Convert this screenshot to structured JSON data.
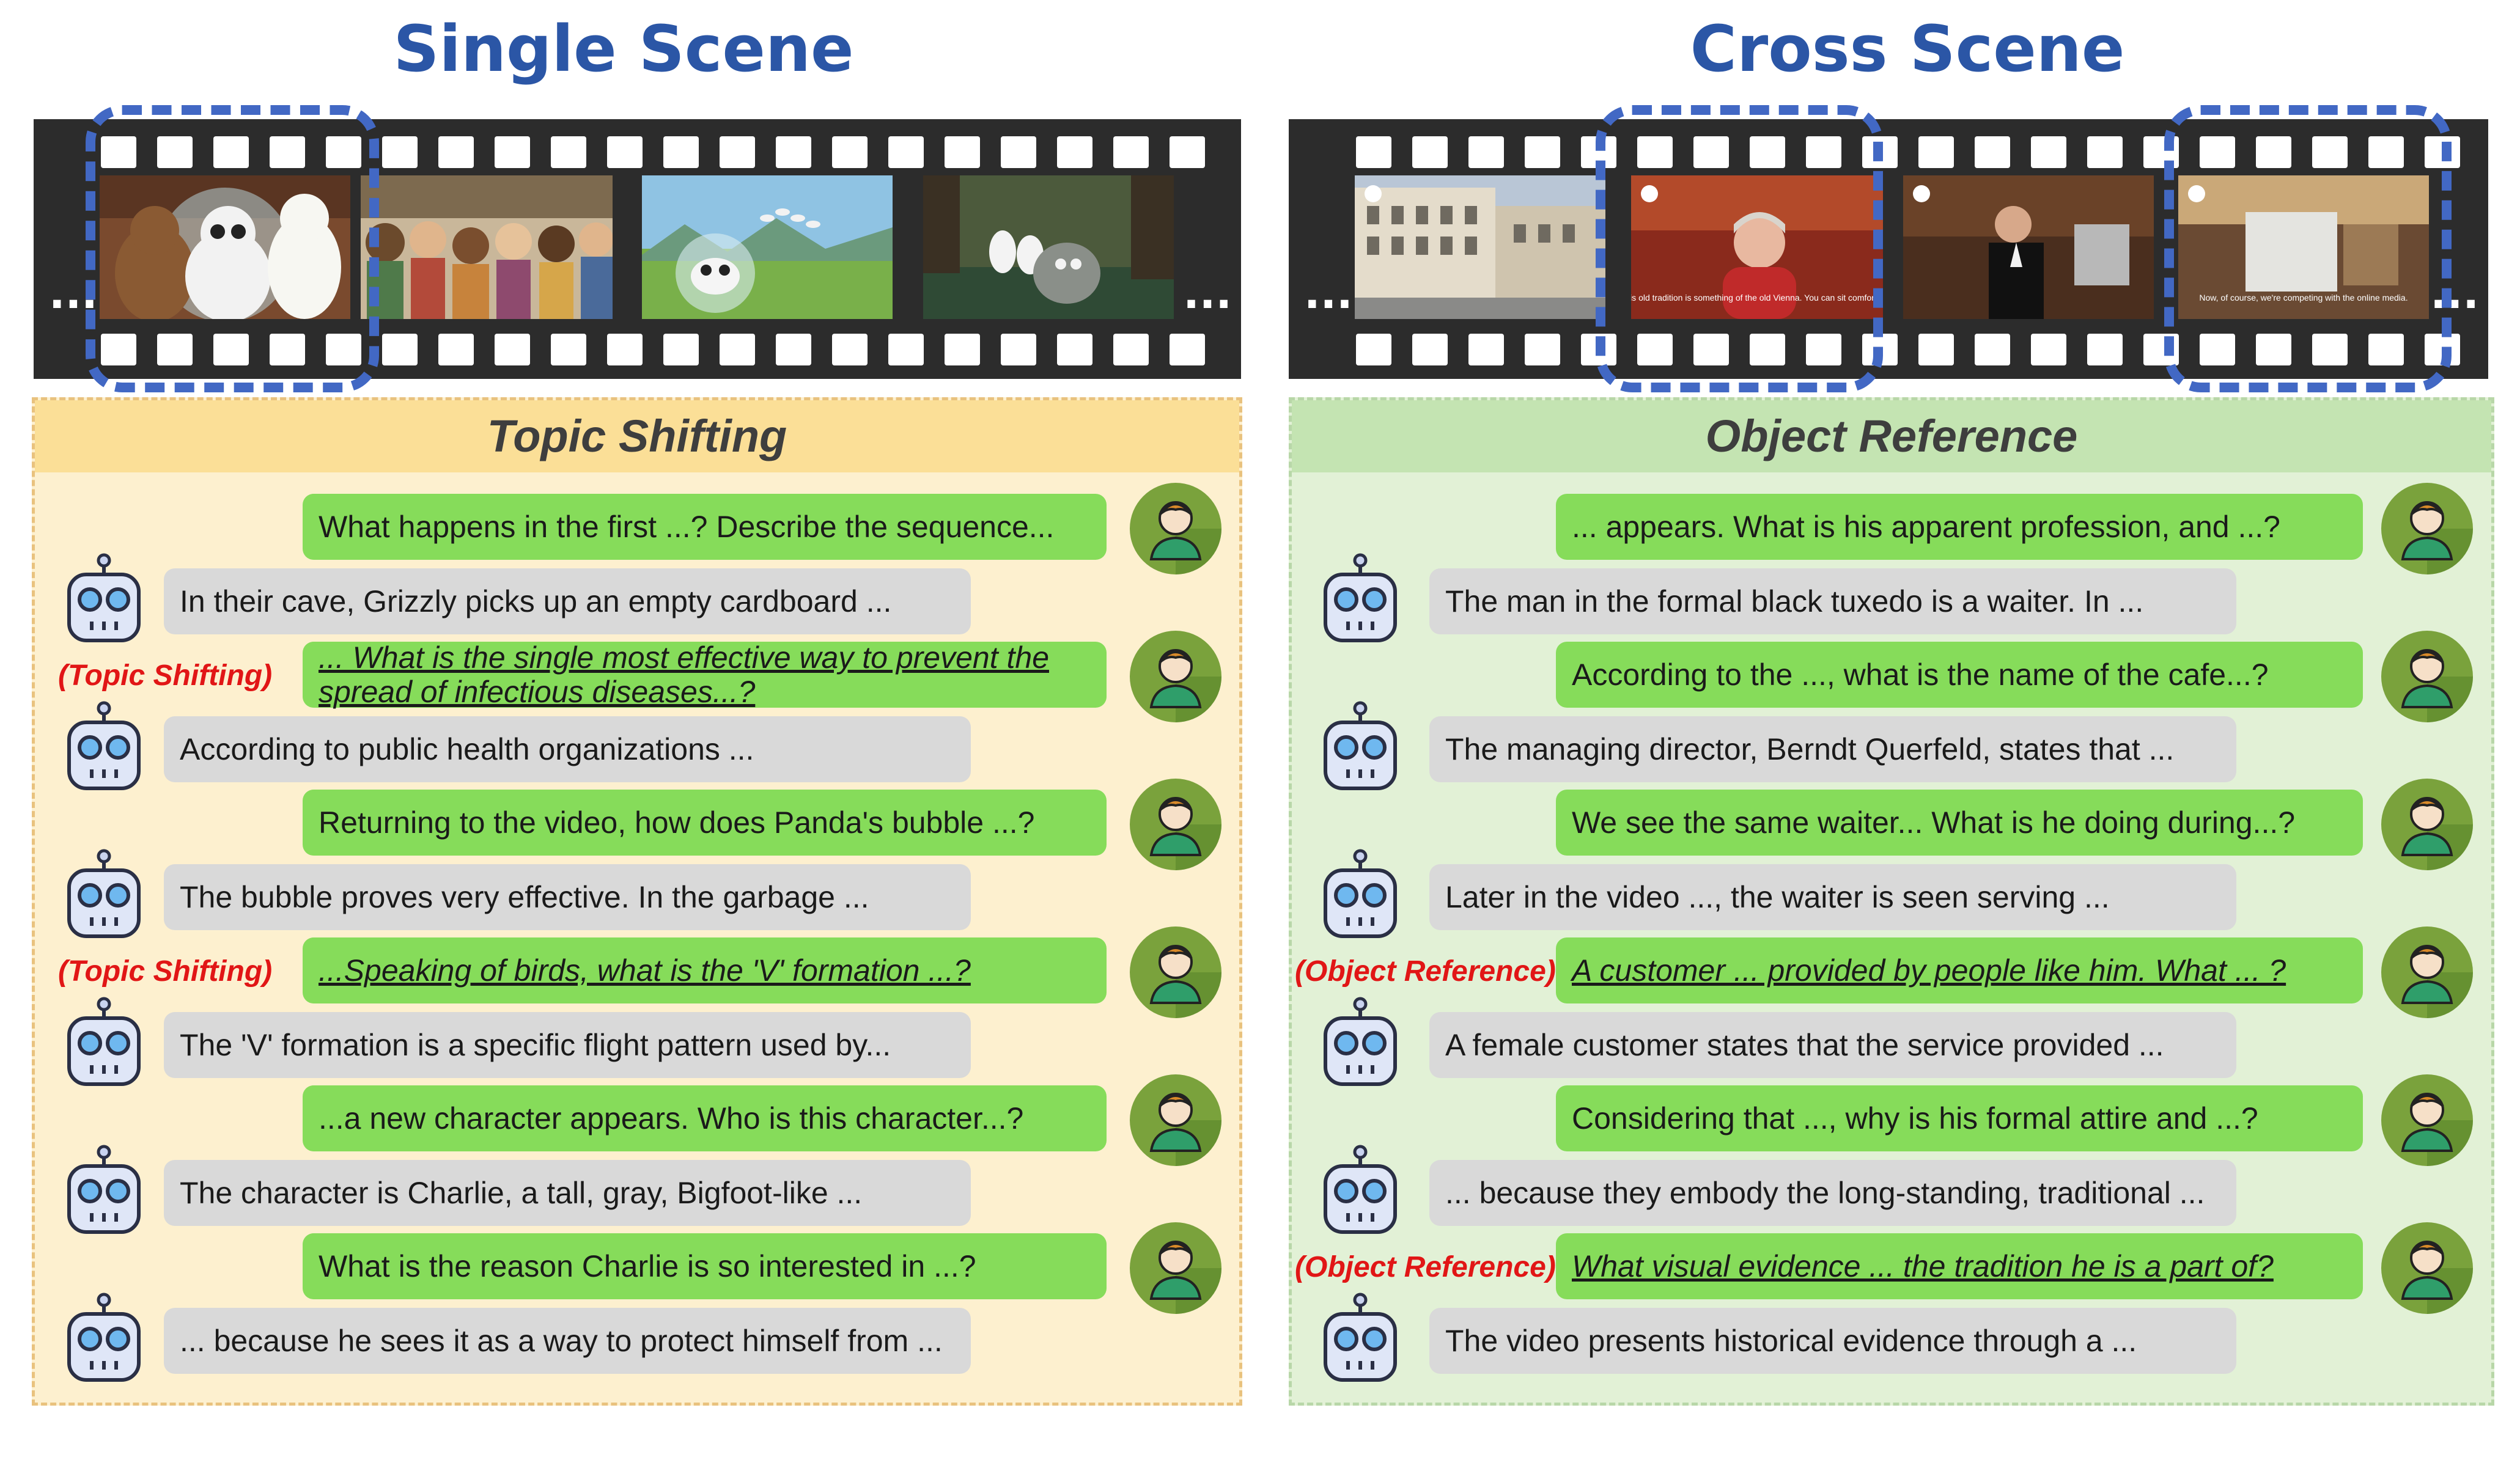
{
  "titles": {
    "single": "Single Scene",
    "cross": "Cross Scene"
  },
  "ellipsis": "...",
  "left_panel": {
    "header": "Topic Shifting",
    "tag": "(Topic Shifting)",
    "turns": [
      {
        "q": "What happens in the first ...? Describe the sequence...",
        "a": "In their cave, Grizzly picks up an empty cardboard  ..."
      },
      {
        "q": "... What is the single most effective way to prevent the spread of infectious diseases...?",
        "a": "According to public health organizations ...",
        "tagged": true
      },
      {
        "q": "Returning to the video, how does Panda's bubble ...?",
        "a": "The bubble proves very effective. In the garbage ..."
      },
      {
        "q": "...Speaking of birds, what is the 'V' formation ...?",
        "a": "The 'V' formation is a specific flight pattern used by...",
        "tagged": true
      },
      {
        "q": "...a new character appears. Who is this character...?",
        "a": "The character is Charlie, a tall, gray, Bigfoot-like ..."
      },
      {
        "q": "What is the reason Charlie is so interested in ...?",
        "a": "... because he sees it as a way to protect himself from ..."
      }
    ]
  },
  "right_panel": {
    "header": "Object Reference",
    "tag": "(Object Reference)",
    "turns": [
      {
        "q": "... appears. What is his apparent profession, and ...?",
        "a": "The man in the formal black tuxedo is a waiter. In ..."
      },
      {
        "q": "According to the ..., what is the name of the cafe...?",
        "a": "The managing director, Berndt Querfeld, states that ..."
      },
      {
        "q": "We see the same waiter... What is he doing during...?",
        "a": "Later in the video ..., the waiter is seen serving ..."
      },
      {
        "q": "A customer ... provided by people like him. What ... ?",
        "a": "A female customer states that the service provided ...",
        "tagged": true
      },
      {
        "q": "Considering that ..., why is his formal attire and ...?",
        "a": "... because they embody the long-standing, traditional ..."
      },
      {
        "q": "What visual evidence ... the tradition he is a part of?",
        "a": "The video presents historical evidence through a ...",
        "tagged": true
      }
    ]
  },
  "frame_captions": {
    "f2": "This old tradition is something of the old Vienna. You can sit comfortably.",
    "f4": "Now, of course, we're competing with the online media."
  },
  "colors": {
    "title": "#2b56a6",
    "dash": "#4268c4",
    "question": "#86dc5a",
    "answer": "#d9d9d9",
    "tag": "#e11616",
    "left_bg": "#fdf0cf",
    "left_head": "#fbdf97",
    "right_bg": "#e2f1d6",
    "right_head": "#c4e4b2"
  }
}
